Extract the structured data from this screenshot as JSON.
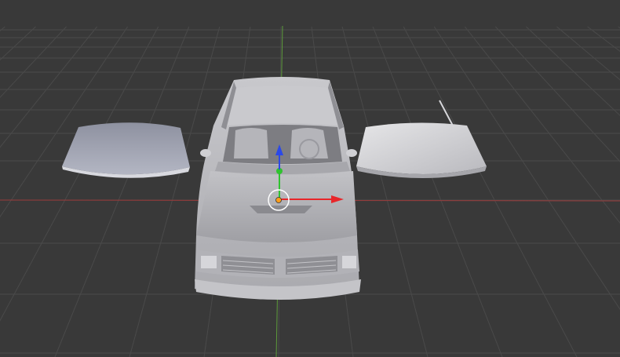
{
  "viewport": {
    "background_color": "#393939",
    "grid_line_color": "#4a4a4a",
    "x_axis_color": "#9b3b3b",
    "y_axis_color": "#5d9b3b"
  },
  "gizmo": {
    "x_arrow_color": "#e8262a",
    "y_arrow_color": "#2fc32f",
    "z_arrow_color": "#2b49e8",
    "origin_color": "#ff9d1a",
    "ring_color": "#ffffff",
    "icons": [
      "x-arrow-icon",
      "y-arrow-icon",
      "z-arrow-icon",
      "origin-icon",
      "rotate-ring-icon"
    ]
  },
  "objects": {
    "car_color": "#bdbdc2",
    "car_shadow_color": "#8d8d92",
    "left_windshield_color": "#a3a6b3",
    "right_windshield_color": "#cfcfd3"
  }
}
